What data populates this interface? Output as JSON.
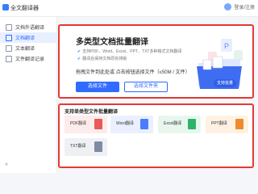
{
  "app": {
    "title": "全文翻译器",
    "user_name": "登录/注册"
  },
  "sidebar": {
    "items": [
      {
        "label": "文档外语翻译",
        "active": false
      },
      {
        "label": "文档翻译",
        "active": true
      },
      {
        "label": "文本翻译",
        "active": false
      },
      {
        "label": "文件翻译记录",
        "active": false
      }
    ],
    "collapse_icon": "double-chevron-left-icon"
  },
  "hero": {
    "title": "多类型文档批量翻译",
    "features": [
      "支持PDF、Word、Excel、PPT、TXT多种格式文档翻译",
      "翻译后保持文档原有排版"
    ],
    "drop_hint": "拖拽文件到此处或 点击按钮选择文件（≤50M / 文件）",
    "primary_button": "选择文件",
    "secondary_button": "选择文件夹",
    "badge": "支持批量"
  },
  "types": {
    "title": "支持单类型文件批量翻译",
    "cards": [
      {
        "label": "PDF翻译",
        "bg": "#fdecec",
        "icon": "#e85a5a"
      },
      {
        "label": "Word翻译",
        "bg": "#eaf0ff",
        "icon": "#4a7dff"
      },
      {
        "label": "Excel翻译",
        "bg": "#e8f7ee",
        "icon": "#2fb36b"
      },
      {
        "label": "PPT翻译",
        "bg": "#fff2e3",
        "icon": "#f08a2d"
      },
      {
        "label": "TXT翻译",
        "bg": "#eef0f4",
        "icon": "#7f8aa3"
      }
    ]
  },
  "colors": {
    "accent": "#2f6bff",
    "highlight_border": "#e53935"
  }
}
